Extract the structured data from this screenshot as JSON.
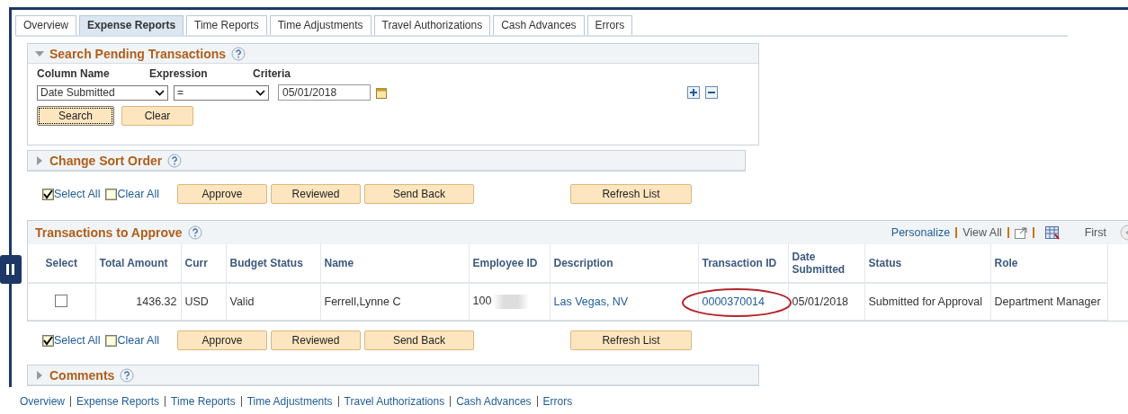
{
  "tabs": [
    {
      "label": "Overview",
      "selected": false
    },
    {
      "label": "Expense Reports",
      "selected": true
    },
    {
      "label": "Time Reports",
      "selected": false
    },
    {
      "label": "Time Adjustments",
      "selected": false
    },
    {
      "label": "Travel Authorizations",
      "selected": false
    },
    {
      "label": "Cash Advances",
      "selected": false
    },
    {
      "label": "Errors",
      "selected": false
    }
  ],
  "search_panel": {
    "title": "Search Pending Transactions",
    "expanded": true,
    "headers": [
      "Column Name",
      "Expression",
      "Criteria"
    ],
    "column_value": "Date Submitted",
    "expression_value": "=",
    "criteria_value": "05/01/2018",
    "buttons": [
      "Search",
      "Clear"
    ]
  },
  "sort_panel": {
    "title": "Change Sort Order",
    "expanded": false
  },
  "top_actions": {
    "select_all": {
      "label": "Select All",
      "checked": true
    },
    "clear_all": {
      "label": "Clear All",
      "checked": false
    },
    "buttons": [
      "Approve",
      "Reviewed",
      "Send Back"
    ],
    "refresh": "Refresh List"
  },
  "grid": {
    "title": "Transactions to Approve",
    "personalize": "Personalize",
    "view_all": "View All",
    "first": "First",
    "columns": [
      "Select",
      "Total Amount",
      "Curr",
      "Budget Status",
      "Name",
      "Employee ID",
      "Description",
      "Transaction ID",
      "Date Submitted",
      "Status",
      "Role"
    ],
    "rows": [
      {
        "checked": false,
        "total_amount": "1436.32",
        "curr": "USD",
        "budget_status": "Valid",
        "name": "Ferrell,Lynne C",
        "employee_id": "100",
        "description": "Las Vegas, NV",
        "transaction_id": "0000370014",
        "highlighted": true,
        "date_submitted": "05/01/2018",
        "status": "Submitted for Approval",
        "role": "Department Manager"
      }
    ]
  },
  "bottom_actions": {
    "select_all": {
      "label": "Select All",
      "checked": true
    },
    "clear_all": {
      "label": "Clear All",
      "checked": false
    },
    "buttons": [
      "Approve",
      "Reviewed",
      "Send Back"
    ],
    "refresh": "Refresh List"
  },
  "comments_panel": {
    "title": "Comments",
    "expanded": false
  },
  "footer_links": [
    "Overview",
    "Expense Reports",
    "Time Reports",
    "Time Adjustments",
    "Travel Authorizations",
    "Cash Advances",
    "Errors"
  ]
}
